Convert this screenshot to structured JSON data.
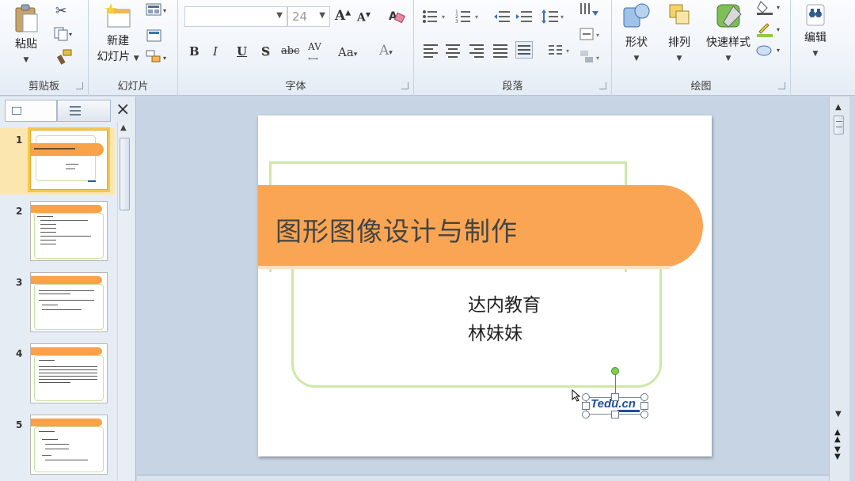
{
  "ribbon": {
    "clipboard": {
      "group_label": "剪贴板",
      "paste_label": "粘贴"
    },
    "slides": {
      "group_label": "幻灯片",
      "new_slide_line1": "新建",
      "new_slide_line2": "幻灯片"
    },
    "font": {
      "group_label": "字体",
      "font_name": "",
      "font_size": "24"
    },
    "paragraph": {
      "group_label": "段落"
    },
    "drawing": {
      "group_label": "绘图",
      "shapes_label": "形状",
      "arrange_label": "排列",
      "quick_styles_label": "快速样式"
    },
    "editing": {
      "label": "编辑"
    }
  },
  "format_buttons": {
    "bold": "B",
    "italic": "I",
    "underline": "U",
    "shadow": "S",
    "strike": "abc",
    "spacing": "AV",
    "case": "Aa",
    "font_color": "A",
    "grow": "A",
    "shrink": "A"
  },
  "slides_panel": {
    "close_symbol": "×",
    "items": [
      {
        "number": "1"
      },
      {
        "number": "2"
      },
      {
        "number": "3"
      },
      {
        "number": "4"
      },
      {
        "number": "5"
      }
    ]
  },
  "slide": {
    "title": "图形图像设计与制作",
    "subtitle_line1": "达内教育",
    "subtitle_line2": "林妹妹",
    "logo_text": "Tedu.cn"
  },
  "colors": {
    "title_bar": "#faa553",
    "frame_green": "#cde8a8",
    "selection_gold": "#f5c84c"
  }
}
